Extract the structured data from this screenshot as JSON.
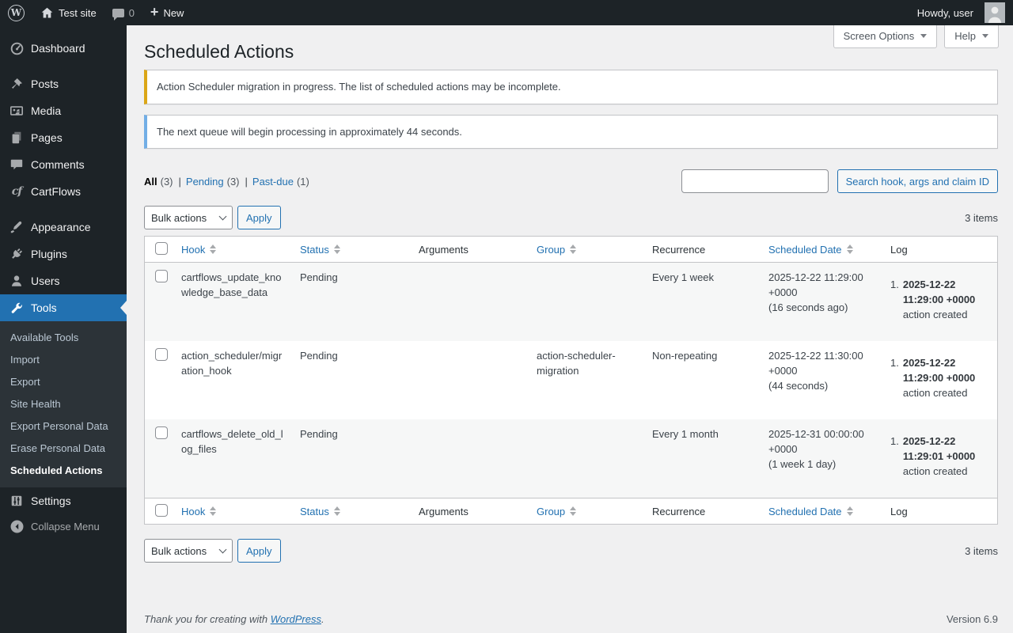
{
  "colors": {
    "admin_bar_bg": "#1d2327",
    "sidebar_bg": "#1d2327",
    "submenu_bg": "#2c3338",
    "accent_blue": "#2271b1",
    "content_bg": "#f0f0f1",
    "notice_warning_border": "#dba617",
    "notice_info_border": "#72aee6",
    "table_alt_row": "#f6f7f7"
  },
  "icons": {
    "wordpress_logo": "W",
    "plus": "+",
    "cartflows": "cf"
  },
  "admin_bar": {
    "site_name": "Test site",
    "comments_count": "0",
    "new_label": "New",
    "howdy": "Howdy, user"
  },
  "sidebar": {
    "menu": [
      {
        "label": "Dashboard"
      },
      {
        "label": "Posts"
      },
      {
        "label": "Media"
      },
      {
        "label": "Pages"
      },
      {
        "label": "Comments"
      },
      {
        "label": "CartFlows"
      },
      {
        "label": "Appearance"
      },
      {
        "label": "Plugins"
      },
      {
        "label": "Users"
      },
      {
        "label": "Tools"
      },
      {
        "label": "Settings"
      }
    ],
    "tools_submenu": [
      {
        "label": "Available Tools"
      },
      {
        "label": "Import"
      },
      {
        "label": "Export"
      },
      {
        "label": "Site Health"
      },
      {
        "label": "Export Personal Data"
      },
      {
        "label": "Erase Personal Data"
      },
      {
        "label": "Scheduled Actions"
      }
    ],
    "collapse_label": "Collapse Menu"
  },
  "page": {
    "title": "Scheduled Actions",
    "screen_options_label": "Screen Options",
    "help_label": "Help"
  },
  "notices": [
    {
      "text": "Action Scheduler migration in progress. The list of scheduled actions may be incomplete."
    },
    {
      "text": "The next queue will begin processing in approximately 44 seconds."
    }
  ],
  "filters": [
    {
      "label": "All",
      "count": "(3)"
    },
    {
      "label": "Pending",
      "count": "(3)"
    },
    {
      "label": "Past-due",
      "count": "(1)"
    }
  ],
  "filters_separator": "|",
  "search": {
    "value": "",
    "button_label": "Search hook, args and claim ID"
  },
  "tablenav": {
    "bulk_actions_label": "Bulk actions",
    "apply_label": "Apply",
    "items_count": "3 items"
  },
  "table": {
    "columns": [
      {
        "label": "Hook",
        "sortable": true
      },
      {
        "label": "Status",
        "sortable": true
      },
      {
        "label": "Arguments",
        "sortable": false
      },
      {
        "label": "Group",
        "sortable": true
      },
      {
        "label": "Recurrence",
        "sortable": false
      },
      {
        "label": "Scheduled Date",
        "sortable": true
      },
      {
        "label": "Log",
        "sortable": false
      }
    ],
    "rows": [
      {
        "hook": "cartflows_update_knowledge_base_data",
        "status": "Pending",
        "arguments": "",
        "group": "",
        "recurrence": "Every 1 week",
        "scheduled_date": "2025-12-22 11:29:00 +0000",
        "scheduled_relative": "(16 seconds ago)",
        "log_index": "1.",
        "log_date": "2025-12-22 11:29:00 +0000",
        "log_text": "action created"
      },
      {
        "hook": "action_scheduler/migration_hook",
        "status": "Pending",
        "arguments": "",
        "group": "action-scheduler-migration",
        "recurrence": "Non-repeating",
        "scheduled_date": "2025-12-22 11:30:00 +0000",
        "scheduled_relative": "(44 seconds)",
        "log_index": "1.",
        "log_date": "2025-12-22 11:29:00 +0000",
        "log_text": "action created"
      },
      {
        "hook": "cartflows_delete_old_log_files",
        "status": "Pending",
        "arguments": "",
        "group": "",
        "recurrence": "Every 1 month",
        "scheduled_date": "2025-12-31 00:00:00 +0000",
        "scheduled_relative": "(1 week 1 day)",
        "log_index": "1.",
        "log_date": "2025-12-22 11:29:01 +0000",
        "log_text": "action created"
      }
    ]
  },
  "footer": {
    "thanks_prefix": "Thank you for creating with",
    "wordpress_label": "WordPress",
    "thanks_suffix": ".",
    "version": "Version 6.9"
  }
}
